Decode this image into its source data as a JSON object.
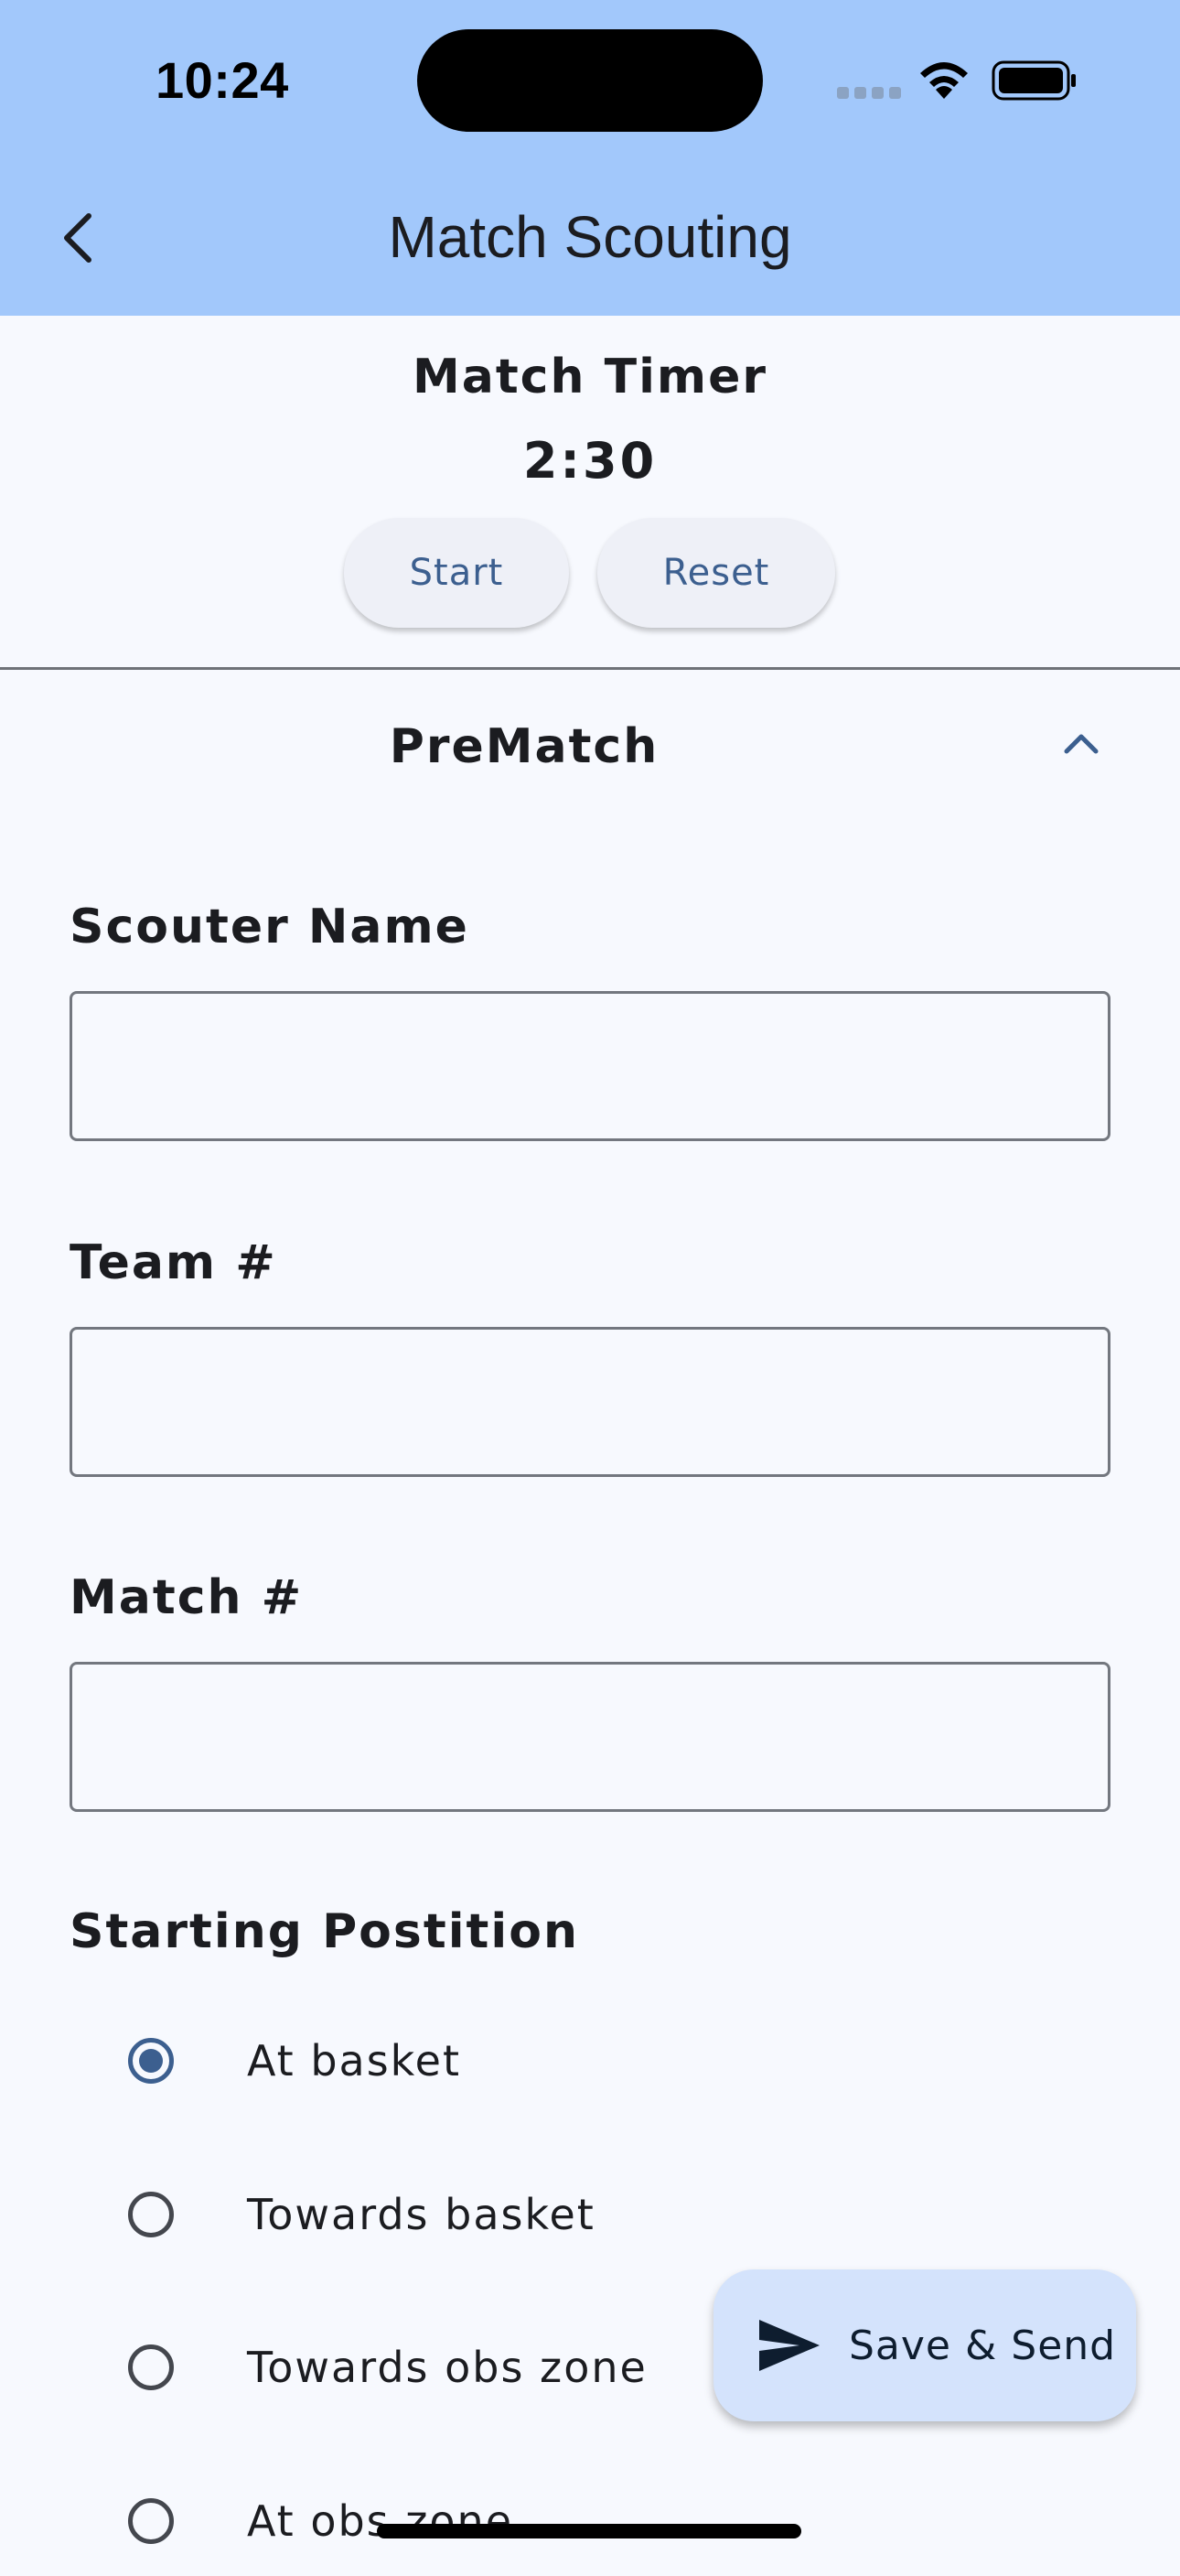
{
  "status_bar": {
    "time": "10:24"
  },
  "header": {
    "title": "Match Scouting",
    "back_icon": "chevron-left-icon"
  },
  "timer": {
    "title": "Match Timer",
    "value": "2:30",
    "start_label": "Start",
    "reset_label": "Reset"
  },
  "prematch": {
    "title": "PreMatch",
    "expanded": true,
    "scouter_name": {
      "label": "Scouter Name",
      "value": ""
    },
    "team_number": {
      "label": "Team #",
      "value": ""
    },
    "match_number": {
      "label": "Match #",
      "value": ""
    },
    "starting_position": {
      "label": "Starting Postition",
      "options": [
        "At basket",
        "Towards basket",
        "Towards obs zone",
        "At obs zone"
      ],
      "selected_index": 0
    }
  },
  "fab": {
    "label": "Save & Send",
    "icon": "send-icon"
  },
  "colors": {
    "header_bg": "#a2c8fb",
    "accent": "#3c5f8f",
    "fab_bg": "#d4e3fc",
    "page_bg": "#f7f9fe"
  }
}
